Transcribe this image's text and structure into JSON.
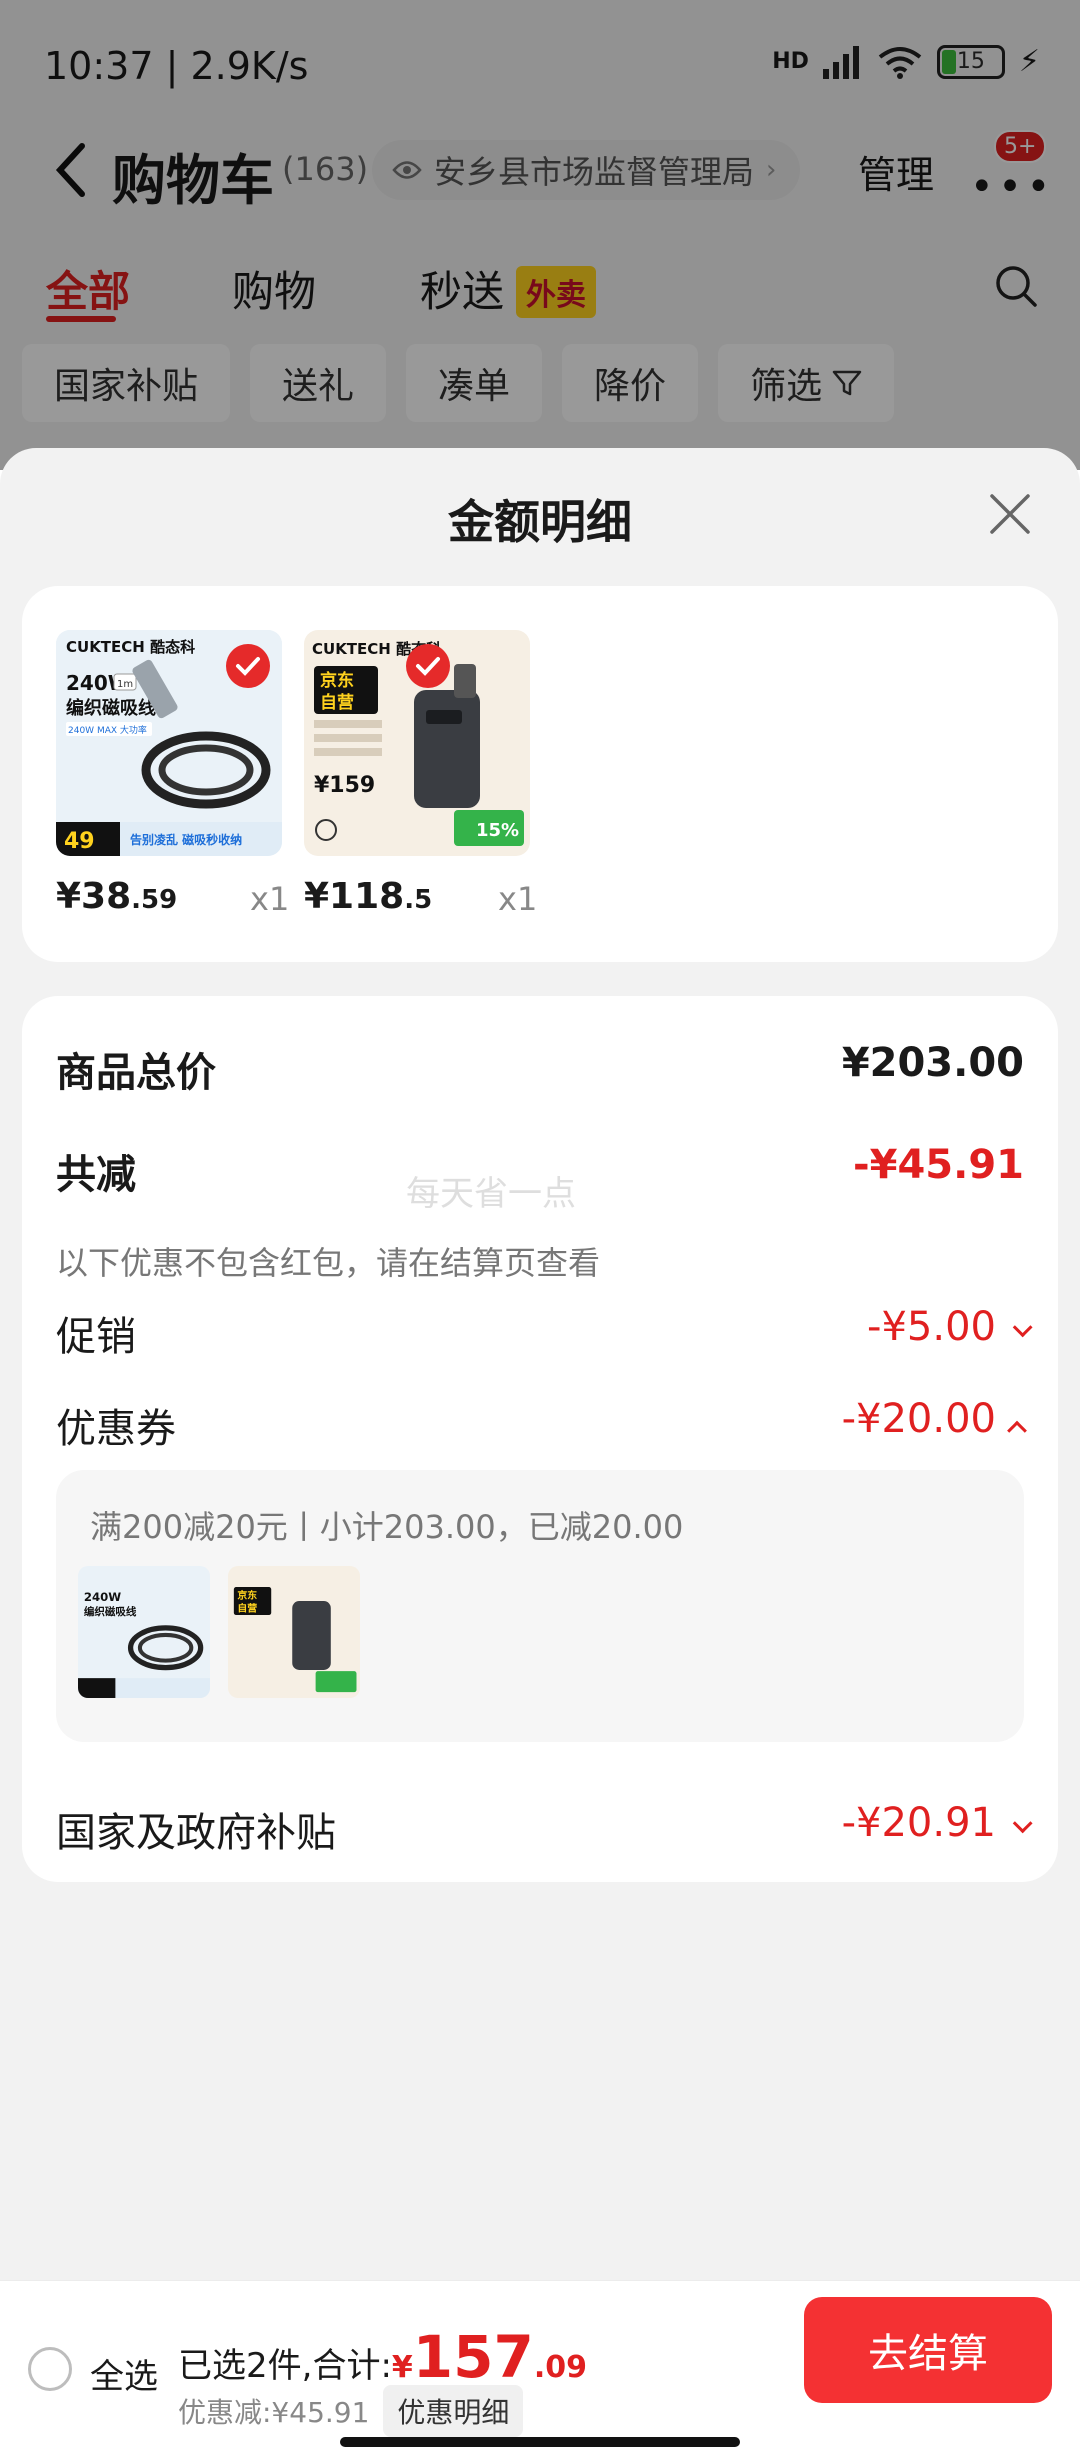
{
  "status_bar": {
    "time": "10:37 | 2.9K/s",
    "battery": "15",
    "network_label": "HD",
    "wifi_label": "6"
  },
  "header": {
    "title": "购物车",
    "count": "(163)",
    "location": "安乡县市场监督管理局",
    "manage_label": "管理",
    "badge": "5+"
  },
  "tabs": [
    {
      "label": "全部",
      "active": true
    },
    {
      "label": "购物",
      "active": false
    },
    {
      "label": "秒送",
      "active": false
    }
  ],
  "takeout_badge": "外卖",
  "chips": [
    "国家补贴",
    "送礼",
    "凑单",
    "降价",
    "筛选"
  ],
  "sheet": {
    "title": "金额明细",
    "products": [
      {
        "brand": "CUKTECH 酷态科",
        "title_lines": [
          "240W",
          "编织磁吸线"
        ],
        "length_tag": "1m",
        "spec": "240W MAX 大功率",
        "footer_text": "告别凌乱 磁吸秒收纳",
        "promo_price": "49",
        "price_int": "¥38",
        "price_dec": ".59",
        "qty": "x1",
        "colors": {
          "bg": "#eaf2f8",
          "accent": "#1e6fd9"
        }
      },
      {
        "brand": "CUKTECH 酷态科",
        "title_lines": [
          "京东",
          "自营"
        ],
        "promo_price": "¥159",
        "footer_text": "15%",
        "price_int": "¥118",
        "price_dec": ".5",
        "qty": "x1",
        "colors": {
          "bg": "#f6efe4",
          "accent": "#34b34a"
        }
      }
    ],
    "summary": {
      "total_label": "商品总价",
      "total_value": "¥203.00",
      "reduce_label": "共减",
      "reduce_value": "-¥45.91",
      "watermark": "每天省一点",
      "note": "以下优惠不包含红包，请在结算页查看",
      "promo_label": "促销",
      "promo_value": "-¥5.00",
      "coupon_label": "优惠券",
      "coupon_value": "-¥20.00",
      "coupon_desc": "满200减20元丨小计203.00，已减20.00",
      "subsidy_label": "国家及政府补贴",
      "subsidy_value": "-¥20.91"
    }
  },
  "bottom_bar": {
    "select_all": "全选",
    "selected_text": "已选2件,合计:",
    "total_currency": "¥",
    "total_int": "157",
    "total_dec": ".09",
    "discount_text": "优惠减:¥45.91",
    "detail_label": "优惠明细",
    "checkout_label": "去结算"
  },
  "colors": {
    "accent_red": "#e02020",
    "checkout_bg": "#f43133",
    "sheet_bg": "#f2f2f2"
  }
}
